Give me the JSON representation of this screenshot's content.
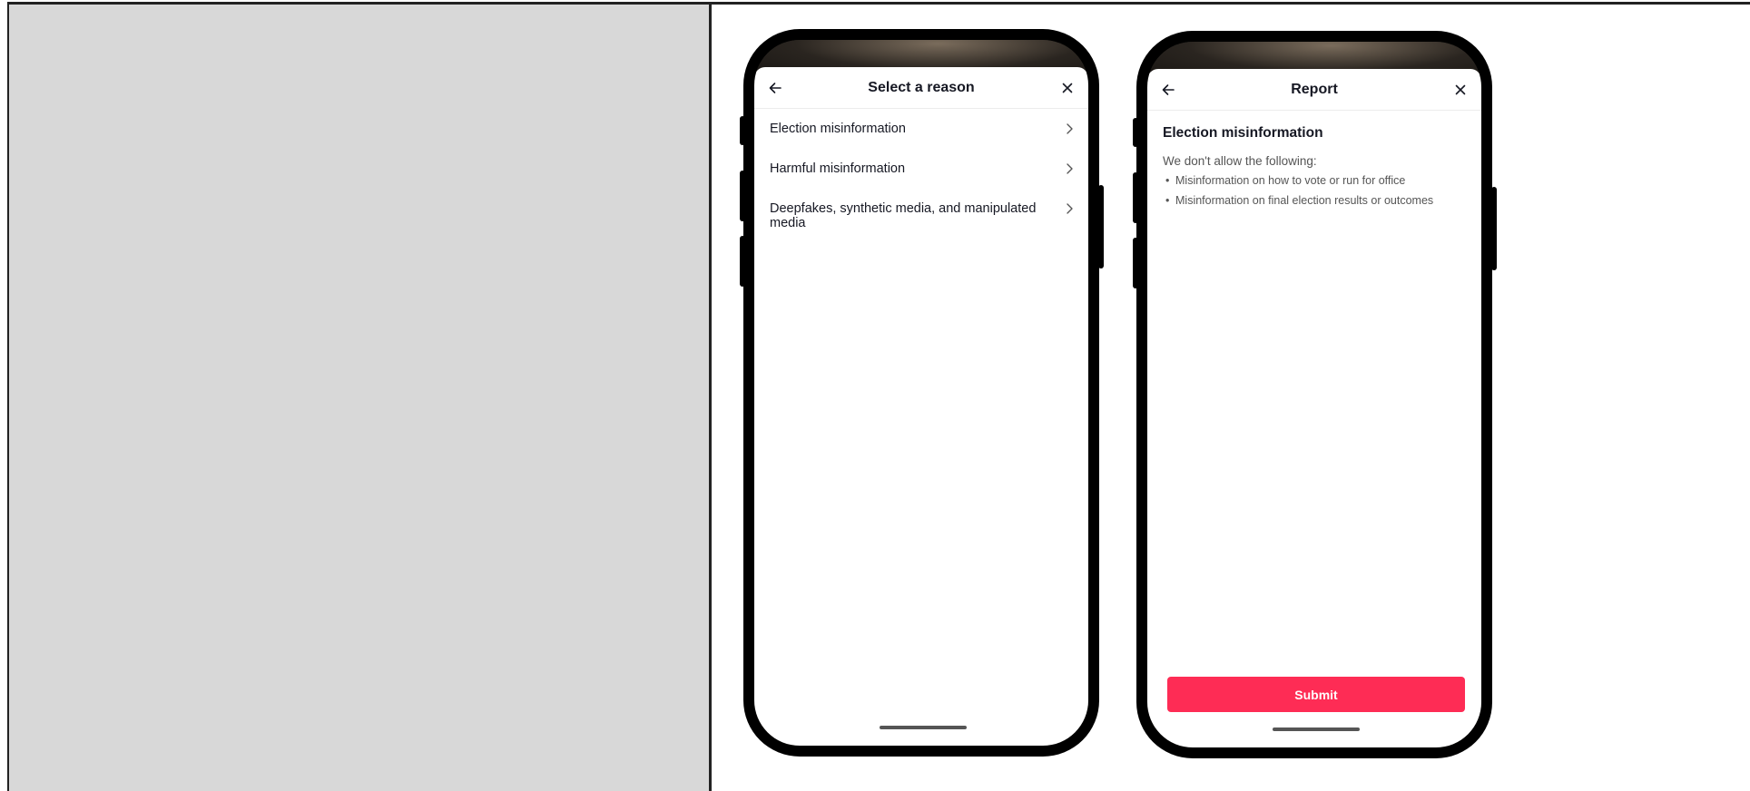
{
  "screen_a": {
    "title": "Select a reason",
    "back_icon": "arrow-left-icon",
    "close_icon": "close-icon",
    "reasons": [
      {
        "label": "Election misinformation"
      },
      {
        "label": "Harmful misinformation"
      },
      {
        "label": "Deepfakes, synthetic media, and manipulated media"
      }
    ]
  },
  "screen_b": {
    "title": "Report",
    "back_icon": "arrow-left-icon",
    "close_icon": "close-icon",
    "heading": "Election misinformation",
    "intro": "We don't allow the following:",
    "items": [
      "Misinformation on how to vote or run for office",
      "Misinformation on final election results or outcomes"
    ],
    "submit_label": "Submit"
  },
  "colors": {
    "accent": "#fe2c55",
    "text_primary": "#161823",
    "text_secondary": "#555555",
    "placeholder_panel": "#d8d8d8"
  }
}
